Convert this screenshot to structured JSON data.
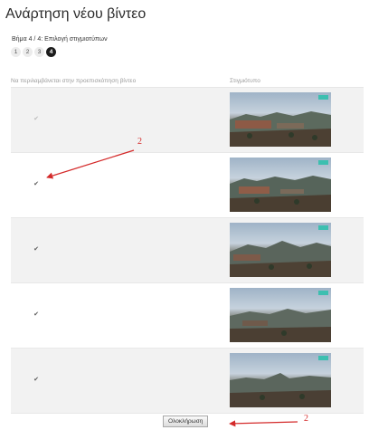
{
  "page": {
    "title": "Ανάρτηση νέου βίντεο"
  },
  "wizard": {
    "step_label": "Βήμα 4 / 4: Επιλογή στιγμιοτύπων",
    "steps": [
      "1",
      "2",
      "3",
      "4"
    ],
    "current_step": 4
  },
  "table": {
    "headers": {
      "include": "Να περιλαμβάνεται στην προεπισκόπηση βίντεο",
      "thumbnail": "Στιγμιότυπο"
    },
    "rows": [
      {
        "checked": true,
        "faded": true
      },
      {
        "checked": true,
        "faded": false
      },
      {
        "checked": true,
        "faded": false
      },
      {
        "checked": true,
        "faded": false
      },
      {
        "checked": true,
        "faded": false
      }
    ]
  },
  "finish_button": {
    "label": "Ολοκλήρωση"
  },
  "annotations": [
    {
      "label": "2",
      "color": "#d42a2a"
    },
    {
      "label": "2",
      "color": "#d42a2a"
    }
  ],
  "colors": {
    "accent": "#3dbfb0",
    "annotation": "#d42a2a",
    "active_step": "#1c1c1c"
  },
  "icons": {
    "check": "check-icon"
  }
}
